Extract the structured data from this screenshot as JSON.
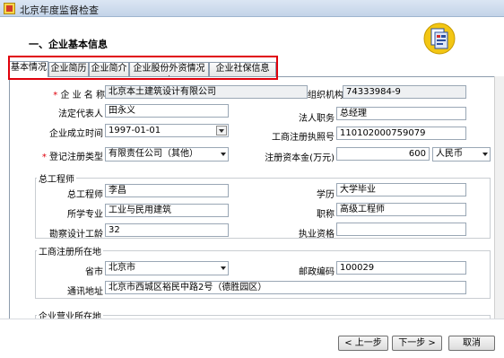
{
  "window": {
    "title": "北京年度监督检查"
  },
  "header": {
    "section_title": "一、企业基本信息",
    "icon": "report-icon"
  },
  "tabs": [
    {
      "label": "基本情况",
      "active": true
    },
    {
      "label": "企业简历",
      "active": false
    },
    {
      "label": "企业简介",
      "active": false
    },
    {
      "label": "企业股份外资情况表",
      "active": false
    },
    {
      "label": "企业社保信息",
      "active": false
    }
  ],
  "basic": {
    "company_name_label": "企 业 名 称",
    "company_name": "北京本土建筑设计有限公司",
    "org_code_label": "组织机构代码",
    "org_code": "74333984-9",
    "legal_rep_label": "法定代表人",
    "legal_rep": "田永义",
    "legal_title_label": "法人职务",
    "legal_title": "总经理",
    "est_date_label": "企业成立时间",
    "est_date": "1997-01-01",
    "biz_reg_no_label": "工商注册执照号",
    "biz_reg_no": "110102000759079",
    "reg_type_label": "登记注册类型",
    "reg_type": "有限责任公司（其他）",
    "capital_label": "注册资本金(万元)",
    "capital": "600",
    "currency": "人民币"
  },
  "chief_engineer": {
    "group_title": "总工程师",
    "name_label": "总工程师",
    "name": "李昌",
    "education_label": "学历",
    "education": "大学毕业",
    "major_label": "所学专业",
    "major": "工业与民用建筑",
    "job_title_label": "职称",
    "job_title": "高级工程师",
    "years_label": "勘察设计工龄",
    "years": "32",
    "license_label": "执业资格",
    "license": ""
  },
  "registration_address": {
    "group_title": "工商注册所在地",
    "province_label": "省市",
    "province": "北京市",
    "postcode_label": "邮政编码",
    "postcode": "100029",
    "address_label": "通讯地址",
    "address": "北京市西城区裕民中路2号（德胜园区）"
  },
  "business_address": {
    "group_title": "企业营业所在地"
  },
  "footer": {
    "prev_label": "< 上一步",
    "next_label": "下一步 >",
    "cancel_label": "取消"
  }
}
